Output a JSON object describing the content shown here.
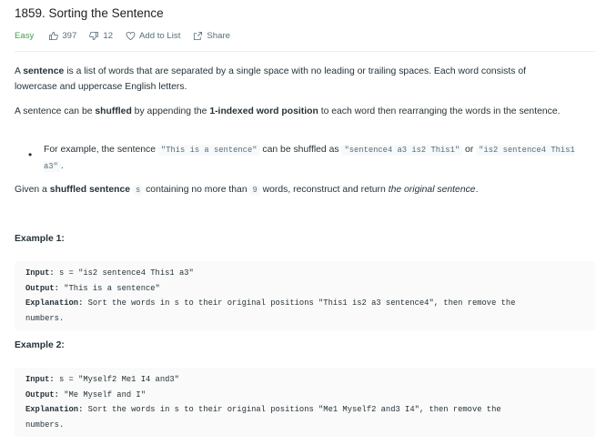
{
  "header": {
    "title": "1859. Sorting the Sentence",
    "difficulty": "Easy",
    "likes": "397",
    "dislikes": "12",
    "add_to_list": "Add to List",
    "share": "Share"
  },
  "description": {
    "p1_a": "A ",
    "p1_b": "sentence",
    "p1_c": " is a list of words that are separated by a single space with no leading or trailing spaces. Each word consists of lowercase and uppercase English letters.",
    "p2_a": "A sentence can be ",
    "p2_b": "shuffled",
    "p2_c": " by appending the ",
    "p2_d": "1-indexed word position",
    "p2_e": " to each word then rearranging the words in the sentence.",
    "li_a": "For example, the sentence ",
    "li_code1": "\"This is a sentence\"",
    "li_b": " can be shuffled as ",
    "li_code2": "\"sentence4 a3 is2 This1\"",
    "li_c": " or ",
    "li_code3": "\"is2 sentence4 This1 a3\"",
    "li_d": ".",
    "p3_a": "Given a ",
    "p3_b": "shuffled sentence",
    "p3_code_s": "s",
    "p3_c": " containing no more than ",
    "p3_code_9": "9",
    "p3_d": " words, reconstruct and return ",
    "p3_e": "the original sentence",
    "p3_f": "."
  },
  "examples": [
    {
      "title": "Example 1:",
      "input_label": "Input:",
      "input": " s = \"is2 sentence4 This1 a3\"",
      "output_label": "Output:",
      "output": " \"This is a sentence\"",
      "explanation_label": "Explanation:",
      "explanation_1": " Sort the words in s to their original positions \"This1 is2 a3 sentence4\", then remove the",
      "explanation_2": "numbers."
    },
    {
      "title": "Example 2:",
      "input_label": "Input:",
      "input": " s = \"Myself2 Me1 I4 and3\"",
      "output_label": "Output:",
      "output": " \"Me Myself and I\"",
      "explanation_label": "Explanation:",
      "explanation_1": " Sort the words in s to their original positions \"Me1 Myself2 and3 I4\", then remove the",
      "explanation_2": "numbers."
    }
  ],
  "icons": {
    "like": "thumbs-up-icon",
    "dislike": "thumbs-down-icon",
    "list": "heart-icon",
    "share": "share-icon"
  },
  "colors": {
    "easy": "#43a047",
    "text": "#263238",
    "muted": "#546e7a",
    "code_bg": "#fafafa"
  }
}
